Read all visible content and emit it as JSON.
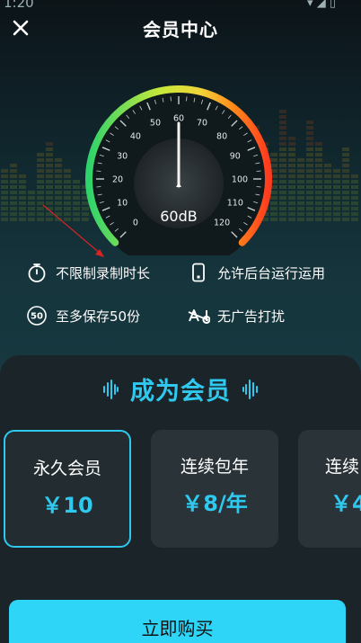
{
  "status": {
    "time": "1:20",
    "icons": "▾ ◢ ▯"
  },
  "header": {
    "title": "会员中心",
    "close_icon": "close-icon"
  },
  "gauge": {
    "ticks": [
      "0",
      "10",
      "20",
      "30",
      "40",
      "50",
      "60",
      "70",
      "80",
      "90",
      "100",
      "110",
      "120"
    ],
    "reading": "60dB",
    "value": 60,
    "max": 120,
    "colors": [
      "#2fd36b",
      "#f0e043",
      "#ff8c1a",
      "#ff3b1f"
    ]
  },
  "features": [
    {
      "icon": "stopwatch-icon",
      "label": "不限制录制时长"
    },
    {
      "icon": "phone-icon",
      "label": "允许后台运行运用"
    },
    {
      "icon": "badge-50-icon",
      "badge": "50",
      "label": "至多保存50份"
    },
    {
      "icon": "no-ad-icon",
      "label": "无广告打扰"
    }
  ],
  "panel": {
    "title": "成为会员",
    "accent": "#2fc9f0",
    "plans": [
      {
        "name": "永久会员",
        "price": "￥10",
        "selected": true
      },
      {
        "name": "连续包年",
        "price": "￥8/年",
        "selected": false
      },
      {
        "name": "连续",
        "price": "￥4",
        "selected": false
      }
    ],
    "buy_label": "立即购买"
  }
}
